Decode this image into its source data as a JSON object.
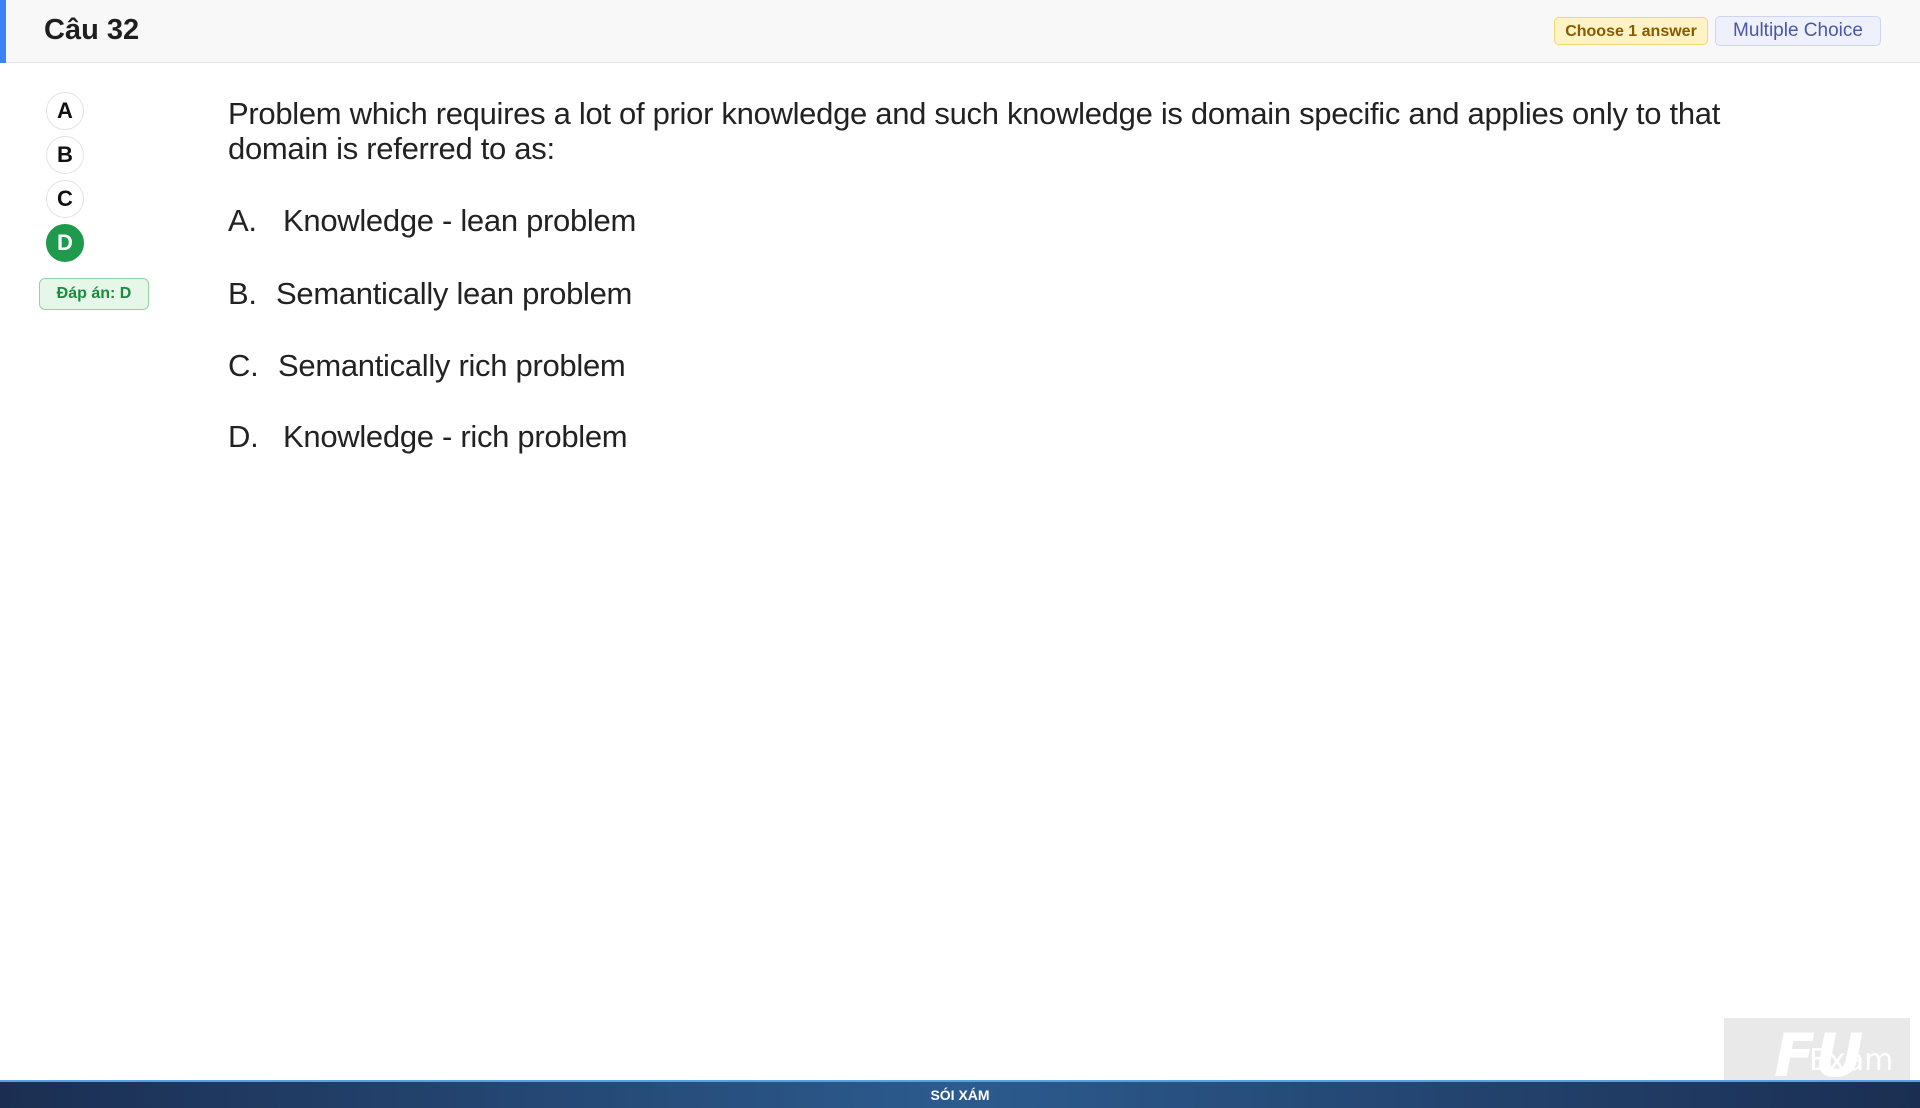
{
  "header": {
    "title": "Câu 32",
    "choose_badge": "Choose 1 answer",
    "type_badge": "Multiple Choice"
  },
  "choices": {
    "items": [
      "A",
      "B",
      "C",
      "D"
    ],
    "selected": "D",
    "answer_label": "Đáp án: D"
  },
  "question": {
    "text": "Problem which requires a lot of prior knowledge and such knowledge is domain specific and applies only to that domain is referred to as:",
    "options": [
      {
        "letter": "A.",
        "text": "Knowledge - lean problem"
      },
      {
        "letter": "B.",
        "text": "Semantically lean problem"
      },
      {
        "letter": "C.",
        "text": "Semantically rich problem"
      },
      {
        "letter": "D.",
        "text": "Knowledge - rich problem"
      }
    ]
  },
  "footer": {
    "text": "SÓI XÁM"
  },
  "watermark": {
    "logo_mark": "FU",
    "logo_text": "Exam"
  },
  "colors": {
    "accent": "#3b82f6",
    "selected_choice": "#1e9a4c",
    "footer_bg": "#1b2e52"
  }
}
